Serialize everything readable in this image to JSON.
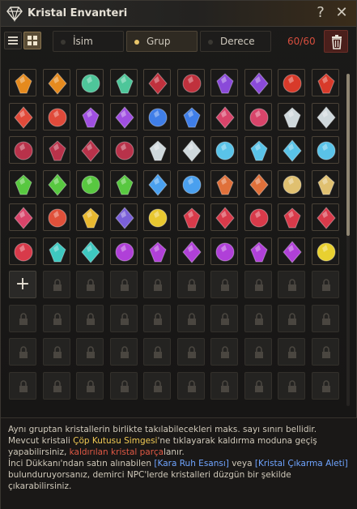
{
  "window": {
    "title": "Kristal Envanteri",
    "help_label": "?",
    "close_label": "✕"
  },
  "toolbar": {
    "sort_options": [
      {
        "label": "İsim",
        "active": false
      },
      {
        "label": "Grup",
        "active": true
      },
      {
        "label": "Derece",
        "active": false
      }
    ],
    "count_text": "60/60",
    "icons": {
      "list_view": "list-view-icon",
      "grid_view": "grid-view-icon",
      "delete": "trash-icon"
    }
  },
  "inventory": {
    "columns": 10,
    "filled_count": 60,
    "total_visible_slots": 100,
    "add_slot_label": "+",
    "crystals": [
      "#e58a1e",
      "#e58a1e",
      "#4ec69a",
      "#4ec69a",
      "#c0313d",
      "#c0313d",
      "#8a4ad9",
      "#8a4ad9",
      "#d83a2a",
      "#d83a2a",
      "#e04a3a",
      "#e04a3a",
      "#9f4fe0",
      "#9f4fe0",
      "#3f7ee8",
      "#3f7ee8",
      "#d8446a",
      "#d8446a",
      "#cfd8dc",
      "#cfd8dc",
      "#b8324a",
      "#b8324a",
      "#b8324a",
      "#b8324a",
      "#cfd8dc",
      "#cfd8dc",
      "#5ac3e8",
      "#5ac3e8",
      "#5ac3e8",
      "#5ac3e8",
      "#58c840",
      "#58c840",
      "#58c840",
      "#58c840",
      "#4aa0ef",
      "#4aa0ef",
      "#e0703a",
      "#e0703a",
      "#e0c070",
      "#e0c070",
      "#d8446a",
      "#e0503a",
      "#e8b830",
      "#7a60d8",
      "#e8c830",
      "#d83a4a",
      "#d83a4a",
      "#d83a4a",
      "#d83a4a",
      "#d83a4a",
      "#d83a4a",
      "#3ec8c0",
      "#3ec8c0",
      "#b040d8",
      "#b040d8",
      "#b040d8",
      "#b040d8",
      "#b040d8",
      "#b040d8",
      "#e8d030"
    ]
  },
  "info": {
    "line1": "Aynı gruptan kristallerin birlikte takılabilecekleri maks. sayı sınırı bellidir.",
    "line2_a": "Mevcut kristali ",
    "line2_hl": "Çöp Kutusu Simgesi",
    "line2_b": "'ne tıklayarak kaldırma moduna geçiş yapabilirsiniz, ",
    "line2_red": "kaldırılan kristal parça",
    "line2_c": "lanır.",
    "line3_a": "İnci Dükkanı'ndan satın alınabilen ",
    "line3_hl1": "[Kara Ruh Esansı]",
    "line3_b": " veya ",
    "line3_hl2": "[Kristal Çıkarma Aleti]",
    "line3_c": " bulunduruyorsanız, demirci NPC'lerde kristalleri düzgün bir şekilde çıkarabilirsiniz."
  }
}
